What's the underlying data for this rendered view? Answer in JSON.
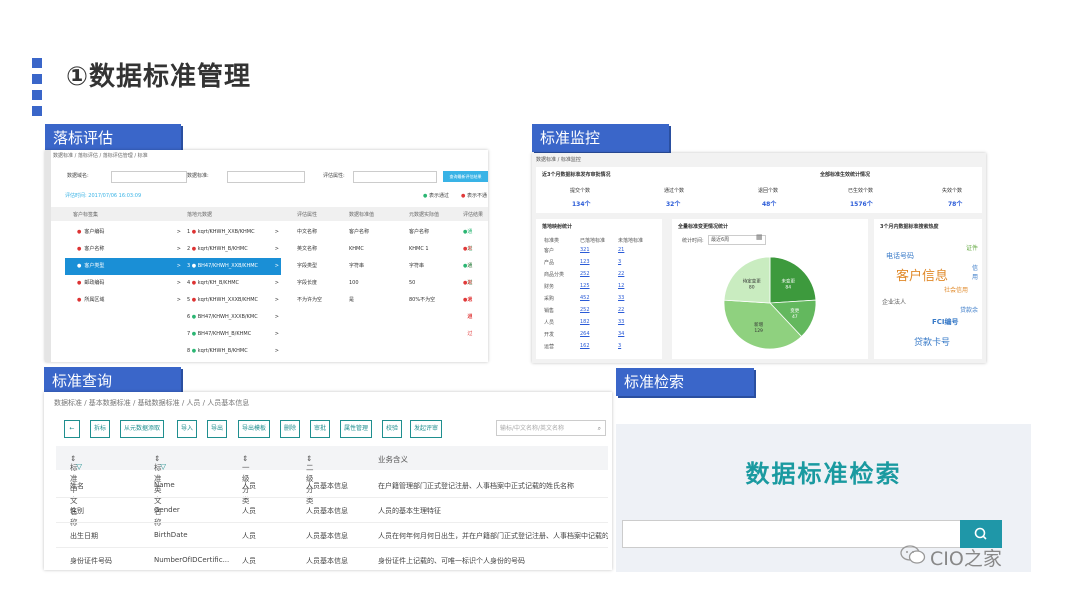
{
  "slide": {
    "title": "①数据标准管理",
    "watermark": "CIO之家"
  },
  "colors": {
    "header_blue": "#3a66c9",
    "select_blue": "#1a8fd6",
    "teal": "#1f8f8f",
    "pass_green": "#2bb673",
    "fail_red": "#e03a3a"
  },
  "panel1": {
    "header": "落标评估",
    "breadcrumb": "数据标准 / 落标评估 / 落标评估管理 / 标准",
    "filters": {
      "domain_label": "数据域名:",
      "standard_label": "数据标准:",
      "attr_label": "评估属性:",
      "query_btn": "查询最新评估结果"
    },
    "eval_time": "评估时间: 2017/07/06 16:03:09",
    "legend_pass": "表示通过",
    "legend_fail": "表示不通",
    "columns": [
      "客户标签集",
      "落地元数据",
      "评估属性",
      "数据标准值",
      "元数据实际值",
      "评估结果"
    ],
    "left_items": [
      "客户编码",
      "客户名称",
      "客户类型",
      "邮政编码",
      "所属区域"
    ],
    "mid_items": [
      "kqrt/KHWH_XXB/KHMC",
      "kqrt/KHWH_B/KHMC",
      "BH47/KHWH_XXB/KHMC",
      "kqrt/KH_B/KHMC",
      "kqrt/KHWH_XXXB/KHMC",
      "BH47/KHWH_XXXB/KMC",
      "BH47/KHWH_B/KHMC",
      "kqrt/KHWH_B/KHMC"
    ],
    "rows": [
      {
        "attr": "中文名称",
        "std": "客户名称",
        "actual": "客户名称",
        "result": "通过"
      },
      {
        "attr": "英文名称",
        "std": "KHMC",
        "actual": "KHMC 1",
        "result": "未通过"
      },
      {
        "attr": "字段类型",
        "std": "字符串",
        "actual": "字符串",
        "result": "通过"
      },
      {
        "attr": "字段长度",
        "std": "100",
        "actual": "50",
        "result": "未通过"
      },
      {
        "attr": "不为许为空",
        "std": "是",
        "actual": "80%不为空",
        "result": "未通过"
      }
    ]
  },
  "panel2": {
    "header": "标准监控",
    "breadcrumb": "数据标准 / 标准监控",
    "kpi_title_a": "近3个月数据标准发布审批情况",
    "kpi_title_b": "全部标准生效统计情况",
    "kpis": [
      {
        "label": "提交个数",
        "value": "134个"
      },
      {
        "label": "通过个数",
        "value": "32个"
      },
      {
        "label": "退回个数",
        "value": "48个"
      },
      {
        "label": "已生效个数",
        "value": "1576个"
      },
      {
        "label": "失效个数",
        "value": "78个"
      }
    ],
    "table_title": "落地映射统计",
    "table_cols": [
      "标准类",
      "已落地标准",
      "未落地标准"
    ],
    "table_rows": [
      [
        "客户",
        "321",
        "21"
      ],
      [
        "产品",
        "123",
        "3"
      ],
      [
        "商品分类",
        "252",
        "22"
      ],
      [
        "财务",
        "125",
        "12"
      ],
      [
        "采购",
        "452",
        "33"
      ],
      [
        "销售",
        "252",
        "22"
      ],
      [
        "人员",
        "182",
        "33"
      ],
      [
        "开发",
        "264",
        "34"
      ],
      [
        "运营",
        "162",
        "3"
      ]
    ],
    "pie_title": "全量标准变更情况统计",
    "pie_filter_label": "统计时间:",
    "pie_filter_value": "最近6周",
    "pie_slices": [
      {
        "label": "未变更",
        "value": "84",
        "share": 0.24
      },
      {
        "label": "变更",
        "value": "47",
        "share": 0.14
      },
      {
        "label": "新增",
        "value": "129",
        "share": 0.38
      },
      {
        "label": "待定变更",
        "value": "80",
        "share": 0.24
      }
    ],
    "cloud_title": "3个月内数据标准搜索热度",
    "cloud_words": [
      "电话号码",
      "证件",
      "信用",
      "客户信息",
      "社会信用",
      "企业法人",
      "贷款余",
      "FCI编号",
      "贷款卡号"
    ]
  },
  "panel3": {
    "header": "标准查询",
    "breadcrumb": "数据标准 / 基本数据标准 / 基础数据标准 / 人员 / 人员基本信息",
    "toolbar": [
      "拆标",
      "从元数据添取",
      "导入",
      "导出",
      "导出模板",
      "删除",
      "审批",
      "属性管理",
      "校验",
      "发起评审"
    ],
    "search_placeholder": "输标/中文名称/英文名称",
    "columns": [
      "标准中文名称",
      "标准英文名称",
      "一级分类",
      "二级分类",
      "业务含义"
    ],
    "rows": [
      [
        "姓名",
        "Name",
        "人员",
        "人员基本信息",
        "在户籍管理部门正式登记注册、人事档案中正式记载的姓氏名称"
      ],
      [
        "性别",
        "Gender",
        "人员",
        "人员基本信息",
        "人员的基本生理特征"
      ],
      [
        "出生日期",
        "BirthDate",
        "人员",
        "人员基本信息",
        "人员在何年何月何日出生，并在户籍部门正式登记注册、人事档案中记载的日期"
      ],
      [
        "身份证件号码",
        "NumberOfIDCertific...",
        "人员",
        "人员基本信息",
        "身份证件上记载的、可唯一标识个人身份的号码"
      ]
    ]
  },
  "panel4": {
    "header": "标准检索",
    "title": "数据标准检索"
  }
}
